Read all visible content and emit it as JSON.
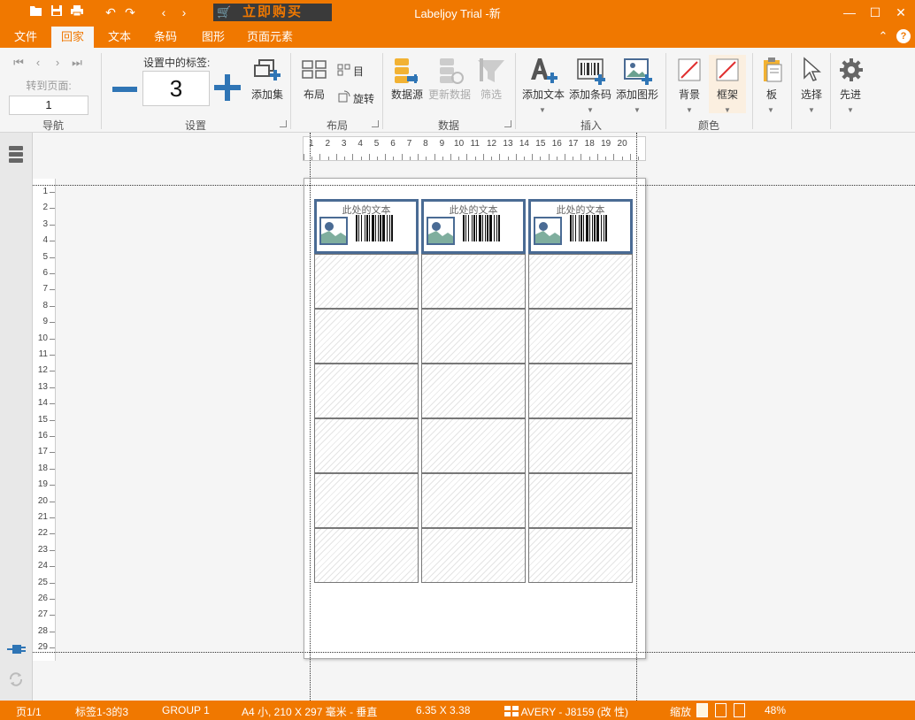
{
  "app": {
    "title": "Labeljoy Trial -新",
    "buy_button": "立即购买"
  },
  "tabs": [
    {
      "label": "文件"
    },
    {
      "label": "回家"
    },
    {
      "label": "文本"
    },
    {
      "label": "条码"
    },
    {
      "label": "图形"
    },
    {
      "label": "页面元素"
    }
  ],
  "ribbon": {
    "nav": {
      "goto_label": "转到页面:",
      "goto_value": "1",
      "group_label": "导航"
    },
    "settings": {
      "labels_in_setup": "设置中的标签:",
      "count": "3",
      "add_set": "添加集",
      "group_label": "设置"
    },
    "layout": {
      "layout_btn": "布局",
      "sequence_btn": "目",
      "rotate_btn": "旋转",
      "group_label": "布局"
    },
    "data": {
      "datasource": "数据源",
      "refresh": "更新数据",
      "filter": "筛选",
      "group_label": "数据"
    },
    "insert": {
      "add_text": "添加文本",
      "add_barcode": "添加条码",
      "add_image": "添加图形",
      "group_label": "插入"
    },
    "color": {
      "background": "背景",
      "frame": "框架",
      "group_label": "颜色"
    },
    "board": "板",
    "select": "选择",
    "advanced": "先进"
  },
  "ruler": {
    "h": [
      "1",
      "2",
      "3",
      "4",
      "5",
      "6",
      "7",
      "8",
      "9",
      "10",
      "11",
      "12",
      "13",
      "14",
      "15",
      "16",
      "17",
      "18",
      "19",
      "20"
    ],
    "v": [
      "1",
      "2",
      "3",
      "4",
      "5",
      "6",
      "7",
      "8",
      "9",
      "10",
      "11",
      "12",
      "13",
      "14",
      "15",
      "16",
      "17",
      "18",
      "19",
      "20",
      "21",
      "22",
      "23",
      "24",
      "25",
      "26",
      "27",
      "28",
      "29"
    ]
  },
  "labels": {
    "placeholder_text": "此处的文本",
    "rows": 7,
    "cols": 3,
    "filled_count": 3
  },
  "status": {
    "page": "页1/1",
    "label_range": "标签1-3的3",
    "group": "GROUP 1",
    "paper": "A4 小, 210 X 297 毫米 - 垂直",
    "label_size": "6.35 X 3.38",
    "template": "AVERY - J8159 (改 性)",
    "zoom_label": "缩放",
    "zoom_value": "48%"
  },
  "colors": {
    "accent": "#f07800",
    "blue": "#2f75b5",
    "label_border": "#4a6b94"
  }
}
